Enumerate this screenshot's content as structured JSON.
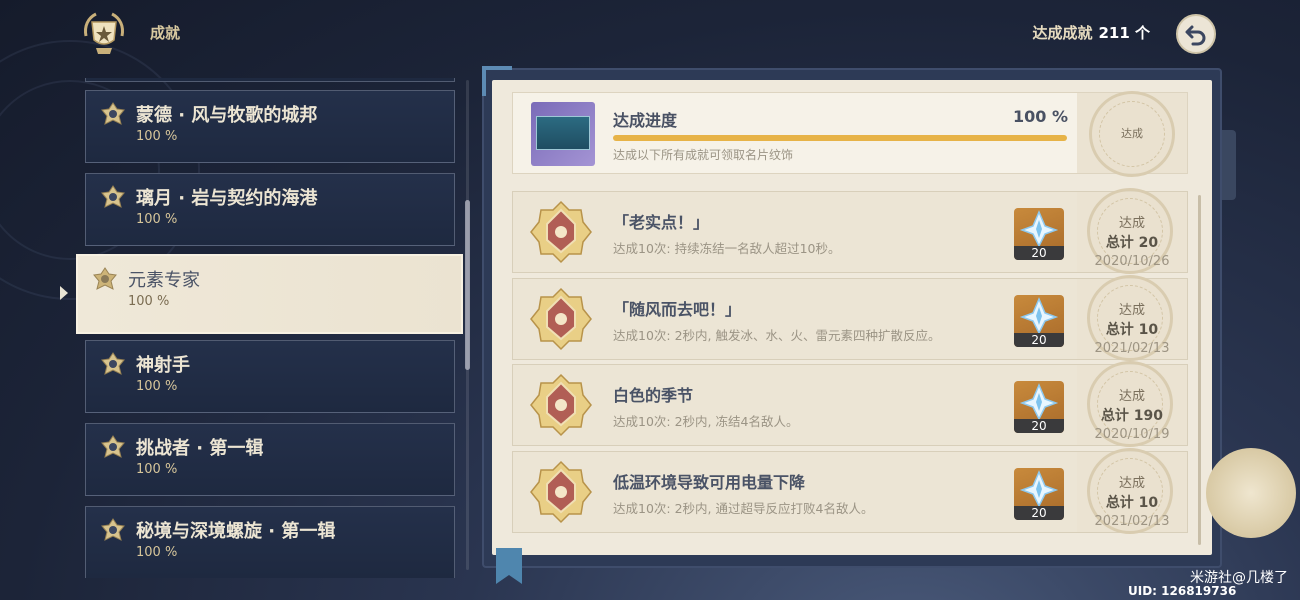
{
  "header": {
    "title": "成就",
    "achievement_count_label": "达成成就",
    "achievement_count_value": "211 个"
  },
  "categories": [
    {
      "name": "蒙德 · 风与牧歌的城邦",
      "percent": "100 %"
    },
    {
      "name": "璃月 · 岩与契约的海港",
      "percent": "100 %"
    },
    {
      "name": "元素专家",
      "percent": "100 %",
      "active": true
    },
    {
      "name": "神射手",
      "percent": "100 %"
    },
    {
      "name": "挑战者 · 第一辑",
      "percent": "100 %"
    },
    {
      "name": "秘境与深境螺旋 · 第一辑",
      "percent": "100 %"
    }
  ],
  "progress": {
    "title": "达成进度",
    "percent_label": "100 %",
    "fraction": 1.0,
    "subtitle": "达成以下所有成就可领取名片纹饰",
    "stamp_text": "达成"
  },
  "achievements": [
    {
      "name": "「老实点！」",
      "desc": "达成10次: 持续冻结一名敌人超过10秒。",
      "reward_qty": "20",
      "stamp": "达成",
      "total": "总计 20",
      "date": "2020/10/26"
    },
    {
      "name": "「随风而去吧！」",
      "desc": "达成10次: 2秒内, 触发冰、水、火、雷元素四种扩散反应。",
      "reward_qty": "20",
      "stamp": "达成",
      "total": "总计 10",
      "date": "2021/02/13"
    },
    {
      "name": "白色的季节",
      "desc": "达成10次: 2秒内, 冻结4名敌人。",
      "reward_qty": "20",
      "stamp": "达成",
      "total": "总计 190",
      "date": "2020/10/19"
    },
    {
      "name": "低温环境导致可用电量下降",
      "desc": "达成10次: 2秒内, 通过超导反应打败4名敌人。",
      "reward_qty": "20",
      "stamp": "达成",
      "total": "总计 10",
      "date": "2021/02/13"
    }
  ],
  "footer": {
    "watermark": "米游社@几楼了",
    "uid": "UID: 126819736"
  },
  "colors": {
    "accent_gold": "#e7b347",
    "panel_bg": "#efe9dc",
    "nav_bg": "#24304a"
  },
  "icons": {
    "header": "trophy-laurel-icon",
    "back": "back-arrow-icon",
    "category": "achievement-badge-icon",
    "medal": "gold-medal-icon",
    "reward": "primogem-icon"
  }
}
